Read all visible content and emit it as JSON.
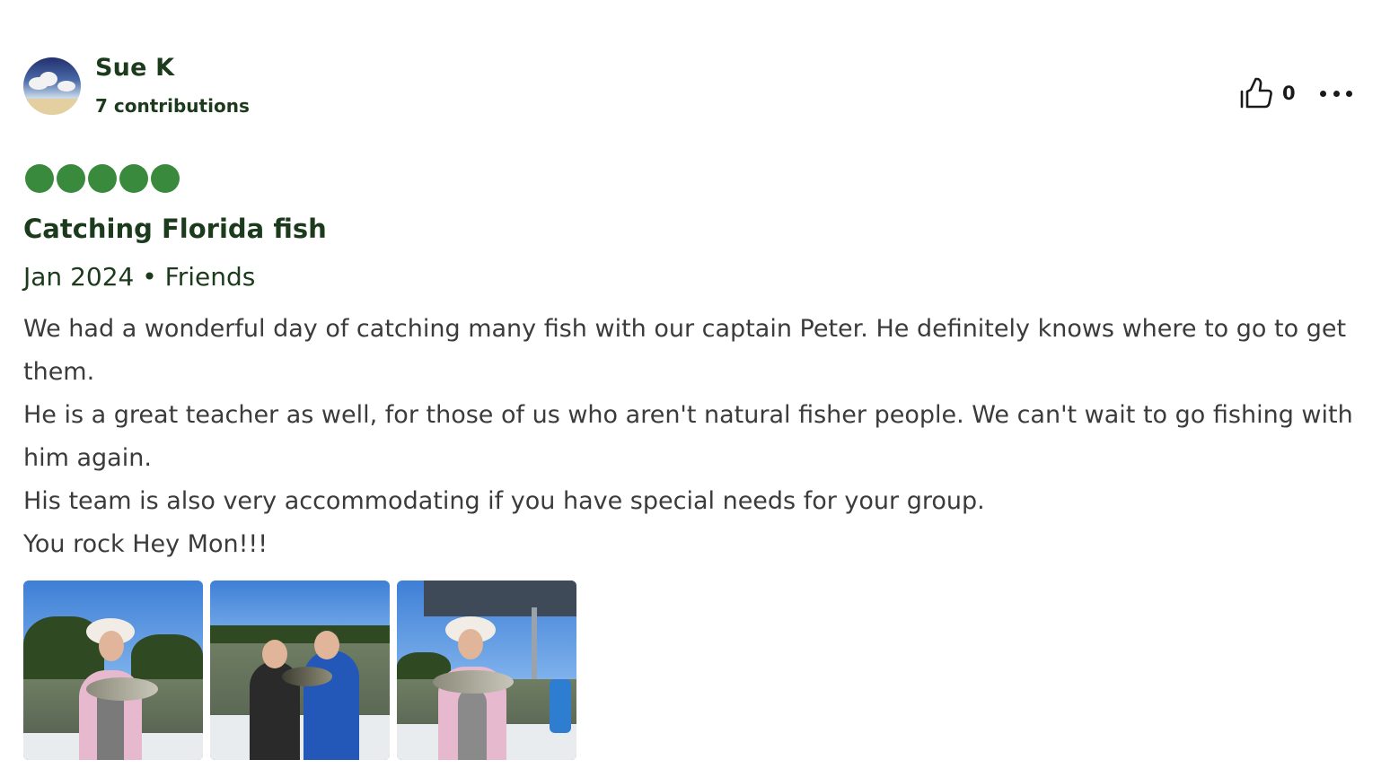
{
  "reviewer": {
    "name": "Sue K",
    "contributions": "7 contributions"
  },
  "helpful": {
    "count": "0"
  },
  "rating": {
    "value": 5,
    "max": 5
  },
  "review": {
    "title": "Catching Florida fish",
    "meta": "Jan 2024 • Friends",
    "paragraphs": [
      "We had a wonderful day of catching many fish with our captain Peter. He definitely knows where to go to get them.",
      "He is a great teacher as well, for those of us who aren't natural fisher people. We can't wait to go fishing with him again.",
      "His team is also very accommodating if you have special needs for your group.",
      "You rock Hey Mon!!!"
    ]
  },
  "icons": {
    "helpful": "thumbs-up-icon",
    "more": "more-options-icon"
  },
  "colors": {
    "brand_green": "#3a8a3d",
    "heading_green": "#1c3a1c"
  }
}
